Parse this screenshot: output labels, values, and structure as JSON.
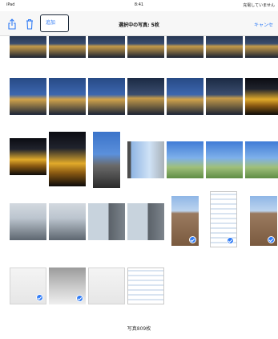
{
  "status_bar": {
    "carrier": "iPad",
    "time": "8:41",
    "charge": "充電していません"
  },
  "navbar": {
    "share_icon": "share-icon",
    "trash_icon": "trash-icon",
    "add_label": "追加",
    "title": "選択中の写真: 5枚",
    "cancel_label": "キャンセ"
  },
  "footer": {
    "photo_count": "写真809枚"
  },
  "colors": {
    "accent": "#2f7bf6",
    "check": "#2f7bf6"
  }
}
